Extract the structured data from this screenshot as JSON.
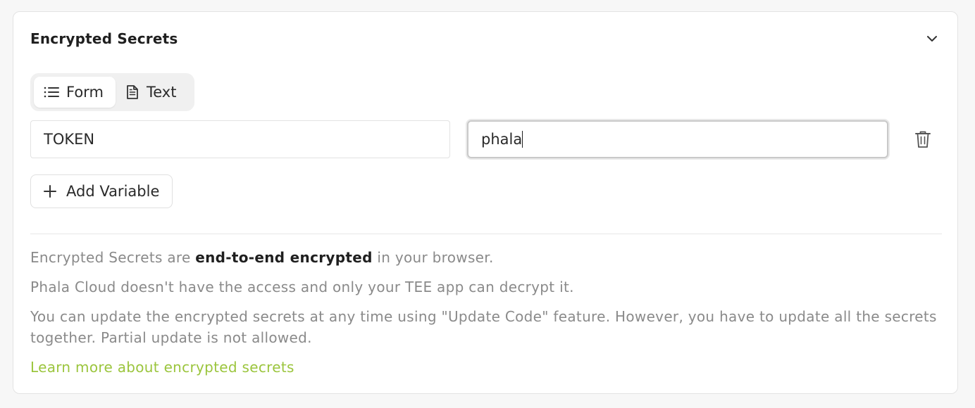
{
  "section": {
    "title": "Encrypted Secrets"
  },
  "mode_toggle": {
    "form_label": "Form",
    "text_label": "Text",
    "active": "Form"
  },
  "variables": [
    {
      "key": "TOKEN",
      "value": "phala"
    }
  ],
  "add_variable_label": "Add Variable",
  "info": {
    "line1_prefix": "Encrypted Secrets are ",
    "line1_bold": "end-to-end encrypted",
    "line1_suffix": " in your browser.",
    "line2": "Phala Cloud doesn't have the access and only your TEE app can decrypt it.",
    "line3": "You can update the encrypted secrets at any time using \"Update Code\" feature. However, you have to update all the secrets together. Partial update is not allowed."
  },
  "learn_more_link": "Learn more about encrypted secrets",
  "colors": {
    "link": "#9bc53d",
    "muted_text": "#8a8a8a"
  },
  "icons": {
    "collapse": "chevron-down-icon",
    "form": "list-icon",
    "text": "document-icon",
    "delete": "trash-icon",
    "add": "plus-icon"
  }
}
